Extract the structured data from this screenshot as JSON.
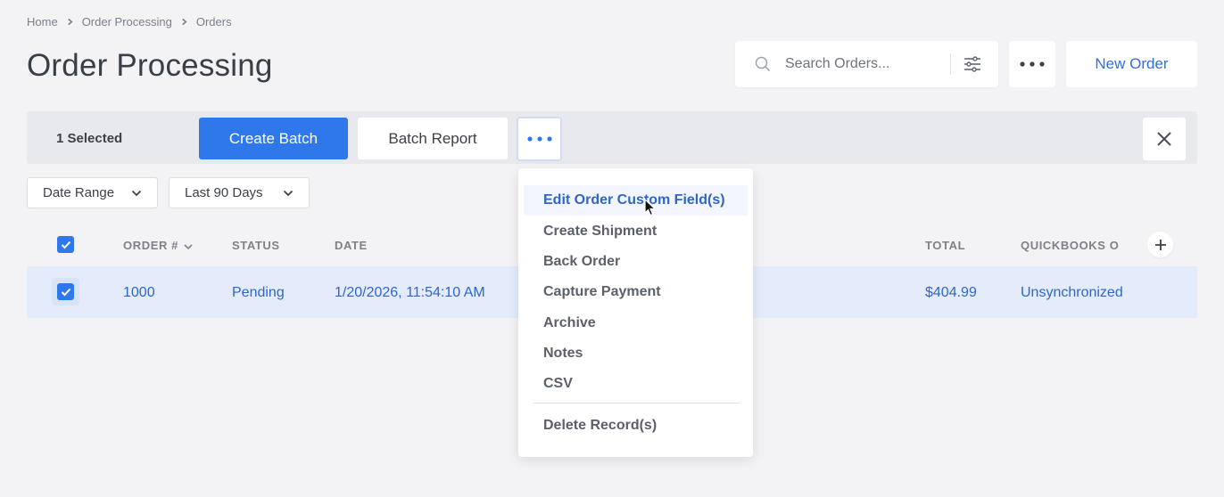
{
  "breadcrumb": [
    "Home",
    "Order Processing",
    "Orders"
  ],
  "page_title": "Order Processing",
  "search": {
    "placeholder": "Search Orders..."
  },
  "new_order_label": "New Order",
  "selection_bar": {
    "count_label": "1 Selected",
    "create_batch_label": "Create Batch",
    "batch_report_label": "Batch Report"
  },
  "filters": [
    {
      "label": "Date Range"
    },
    {
      "label": "Last 90 Days"
    }
  ],
  "table": {
    "columns": {
      "order": "ORDER #",
      "status": "STATUS",
      "date": "DATE",
      "total": "TOTAL",
      "quickbooks": "QUICKBOOKS O"
    },
    "rows": [
      {
        "order": "1000",
        "status": "Pending",
        "date": "1/20/2026, 11:54:10 AM",
        "total": "$404.99",
        "quickbooks": "Unsynchronized",
        "selected": true
      }
    ]
  },
  "menu": {
    "items": [
      "Edit Order Custom Field(s)",
      "Create Shipment",
      "Back Order",
      "Capture Payment",
      "Archive",
      "Notes",
      "CSV"
    ],
    "danger_item": "Delete Record(s)"
  },
  "colors": {
    "primary": "#2f78ec",
    "link": "#2f66c8",
    "background": "#f3f3f5",
    "row_selected": "#e4ecfb"
  },
  "icons": {
    "search": "search-icon",
    "filter": "sliders-icon",
    "more": "more-horizontal-icon",
    "close": "close-icon",
    "chevron": "chevron-down-icon",
    "add": "plus-icon",
    "check": "check-icon"
  }
}
